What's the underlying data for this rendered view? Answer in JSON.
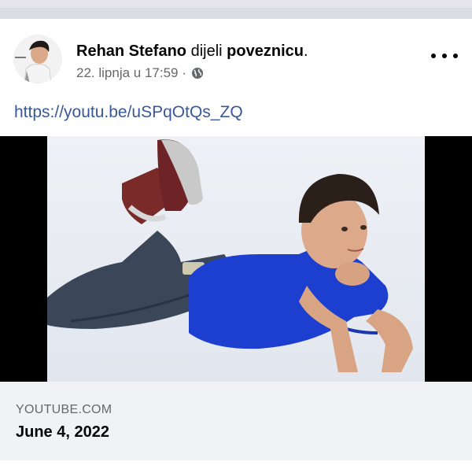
{
  "post": {
    "author_name": "Rehan Stefano",
    "action_verb": " dijeli ",
    "action_object": "poveznicu",
    "action_end": ".",
    "timestamp": "22. lipnja u 17:59 ·",
    "privacy_icon": "globe-icon",
    "more_icon": "more-horizontal-icon",
    "link_text": "https://youtu.be/uSPqOtQs_ZQ"
  },
  "link_preview": {
    "domain": "YOUTUBE.COM",
    "title": "June 4, 2022"
  },
  "colors": {
    "link": "#385898",
    "secondary_text": "#65676b",
    "preview_bg": "#f0f2f5",
    "shirt": "#1c3fcf"
  }
}
